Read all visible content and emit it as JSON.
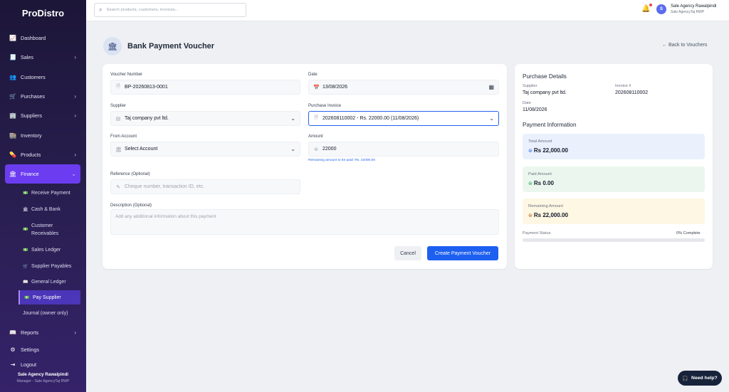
{
  "app": {
    "name": "ProDistro"
  },
  "sidebar": {
    "items": [
      {
        "label": "Dashboard",
        "icon": "chart-line-icon",
        "glyph": "📈"
      },
      {
        "label": "Sales",
        "icon": "receipt-icon",
        "glyph": "🧾",
        "chevron": "›"
      },
      {
        "label": "Customers",
        "icon": "users-icon",
        "glyph": "👥"
      },
      {
        "label": "Purchases",
        "icon": "cart-icon",
        "glyph": "🛒",
        "chevron": "›"
      },
      {
        "label": "Suppliers",
        "icon": "building-icon",
        "glyph": "🏢",
        "chevron": "›"
      },
      {
        "label": "Inventory",
        "icon": "warehouse-icon",
        "glyph": "🏬"
      },
      {
        "label": "Products",
        "icon": "capsule-icon",
        "glyph": "💊",
        "chevron": "›"
      },
      {
        "label": "Finance",
        "icon": "bank-icon",
        "glyph": "🏛",
        "chevron": "⌄"
      }
    ],
    "finance_sub": [
      {
        "label": "Receive Payment",
        "glyph": "💵"
      },
      {
        "label": "Cash & Bank",
        "glyph": "🏛"
      },
      {
        "label_1": "Customer",
        "label_2": "Receivables",
        "glyph": "💵"
      },
      {
        "label": "Sales Ledger",
        "glyph": "💵"
      },
      {
        "label": "Supplier Payables",
        "glyph": "🛒"
      },
      {
        "label": "General Ledger",
        "glyph": "📖"
      },
      {
        "label": "Pay Supplier",
        "glyph": "💵"
      },
      {
        "label": "Journal (owner only)"
      }
    ],
    "bottom_items": [
      {
        "label": "Reports",
        "glyph": "📖",
        "chevron": "›"
      },
      {
        "label": "Settings",
        "glyph": "⚙"
      },
      {
        "label": "Logout",
        "glyph": "⇥"
      }
    ],
    "footer": {
      "name": "Sale Agency Rawalpindi",
      "role": "Manager - Sale AgencyTaj RWP"
    }
  },
  "topbar": {
    "search_placeholder": "Search products, customers, invoices...",
    "avatar_letter": "S",
    "user_name": "Sale Agency Rawalpindi",
    "user_sub": "Sale AgencyTaj RWP"
  },
  "page": {
    "title": "Bank Payment Voucher",
    "back_label": "Back to Vouchers"
  },
  "form": {
    "voucher_number_label": "Voucher Number",
    "voucher_number": "BP-20260813-0001",
    "date_label": "Date",
    "date": "13/08/2026",
    "supplier_label": "Supplier",
    "supplier": "Taj company pvt ltd.",
    "invoice_label": "Purchase Invoice",
    "invoice": "202608110002 - Rs. 22000.00 (11/08/2026)",
    "from_account_label": "From Account",
    "from_account": "Select Account",
    "amount_label": "Amount",
    "amount": "22000",
    "remaining_hint": "Remaining amount to be paid: Rs. 22000.00",
    "reference_label": "Reference (Optional)",
    "reference_placeholder": "Cheque number, transaction ID, etc.",
    "description_label": "Description (Optional)",
    "description_placeholder": "Add any additional information about this payment",
    "cancel_label": "Cancel",
    "create_label": "Create Payment Voucher"
  },
  "purchase_details": {
    "heading": "Purchase Details",
    "supplier_label": "Supplier",
    "supplier": "Taj company pvt ltd.",
    "invoice_label": "Invoice #",
    "invoice": "202608110002",
    "date_label": "Date",
    "date": "11/08/2026"
  },
  "payment_info": {
    "heading": "Payment Information",
    "total_label": "Total Amount",
    "total": "Rs 22,000.00",
    "paid_label": "Paid Amount",
    "paid": "Rs 0.00",
    "remaining_label": "Remaining Amount",
    "remaining": "Rs 22,000.00",
    "status_label": "Payment Status",
    "status_value": "0% Complete",
    "progress_percent": 0
  },
  "help": {
    "label": "Need help?"
  },
  "colors": {
    "accent": "#1d5ff0",
    "sidebar_active": "#6b3cf0",
    "sidebar_bg": "#241a48"
  }
}
